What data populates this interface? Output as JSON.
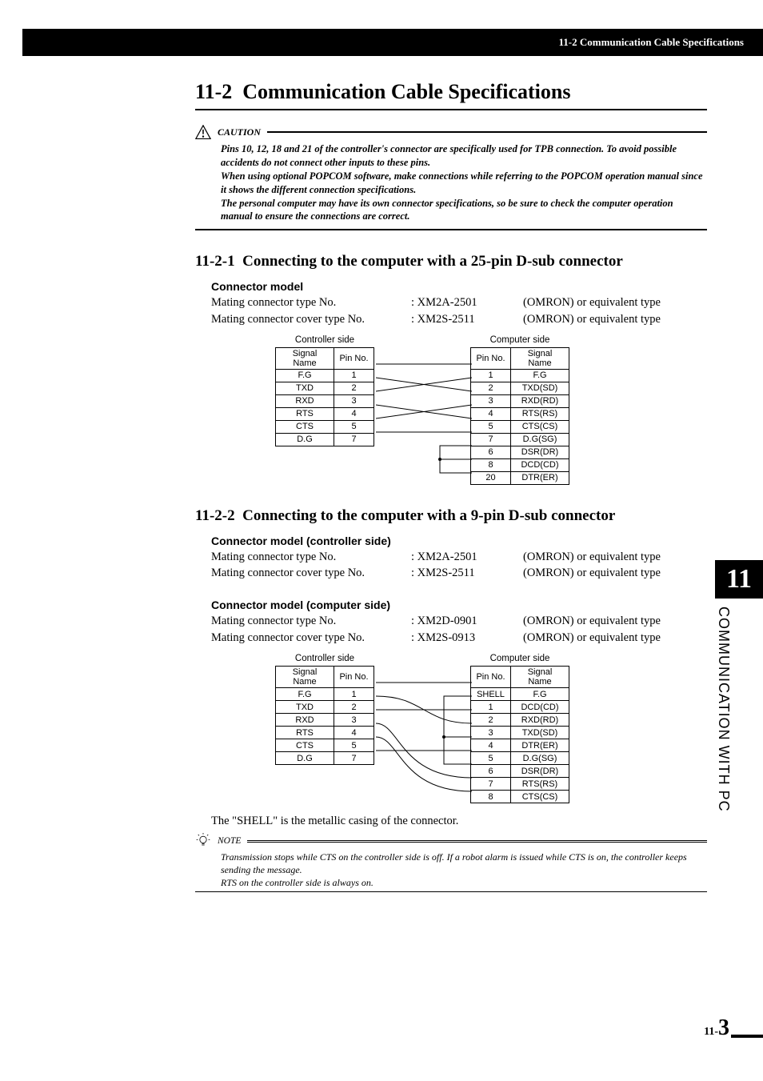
{
  "header": {
    "running_title": "11-2 Communication Cable Specifications"
  },
  "sidebar": {
    "chapter_number": "11",
    "vertical_label": "COMMUNICATION WITH PC"
  },
  "title": {
    "number": "11-2",
    "text": "Communication Cable Specifications"
  },
  "caution": {
    "label": "CAUTION",
    "lines": [
      "Pins 10, 12, 18 and 21 of the controller's connector are specifically used for TPB connection. To avoid possible accidents do not connect other inputs to these pins.",
      "When using optional POPCOM software, make connections while referring to the POPCOM operation manual since it shows the different connection specifications.",
      "The personal computer may have its own connector specifications, so be sure to check the computer operation manual to ensure the connections are correct."
    ]
  },
  "section_25pin": {
    "heading_number": "11-2-1",
    "heading_text": "Connecting to the computer with a 25-pin D-sub connector",
    "connector_label": "Connector model",
    "specs": [
      {
        "label": "Mating connector type No.",
        "value": ": XM2A-2501",
        "brand": "(OMRON) or equivalent type"
      },
      {
        "label": "Mating connector cover type No.",
        "value": ": XM2S-2511",
        "brand": "(OMRON) or equivalent type"
      }
    ],
    "controller_label": "Controller side",
    "computer_label": "Computer side",
    "table_headers": {
      "signal": "Signal Name",
      "pin": "Pin No."
    },
    "controller_rows": [
      {
        "signal": "F.G",
        "pin": "1"
      },
      {
        "signal": "TXD",
        "pin": "2"
      },
      {
        "signal": "RXD",
        "pin": "3"
      },
      {
        "signal": "RTS",
        "pin": "4"
      },
      {
        "signal": "CTS",
        "pin": "5"
      },
      {
        "signal": "D.G",
        "pin": "7"
      }
    ],
    "computer_rows": [
      {
        "pin": "1",
        "signal": "F.G"
      },
      {
        "pin": "2",
        "signal": "TXD(SD)"
      },
      {
        "pin": "3",
        "signal": "RXD(RD)"
      },
      {
        "pin": "4",
        "signal": "RTS(RS)"
      },
      {
        "pin": "5",
        "signal": "CTS(CS)"
      },
      {
        "pin": "7",
        "signal": "D.G(SG)"
      },
      {
        "pin": "6",
        "signal": "DSR(DR)"
      },
      {
        "pin": "8",
        "signal": "DCD(CD)"
      },
      {
        "pin": "20",
        "signal": "DTR(ER)"
      }
    ]
  },
  "section_9pin": {
    "heading_number": "11-2-2",
    "heading_text": "Connecting to the computer with a 9-pin D-sub connector",
    "controller_connector_label": "Connector model (controller side)",
    "controller_specs": [
      {
        "label": "Mating connector type No.",
        "value": ": XM2A-2501",
        "brand": "(OMRON) or equivalent type"
      },
      {
        "label": "Mating connector cover type No.",
        "value": ": XM2S-2511",
        "brand": "(OMRON) or equivalent type"
      }
    ],
    "computer_connector_label": "Connector model (computer side)",
    "computer_specs": [
      {
        "label": "Mating connector type No.",
        "value": ": XM2D-0901",
        "brand": "(OMRON) or equivalent type"
      },
      {
        "label": "Mating connector cover type No.",
        "value": ": XM2S-0913",
        "brand": "(OMRON) or equivalent type"
      }
    ],
    "controller_label": "Controller side",
    "computer_label": "Computer side",
    "table_headers": {
      "signal": "Signal Name",
      "pin": "Pin No."
    },
    "controller_rows": [
      {
        "signal": "F.G",
        "pin": "1"
      },
      {
        "signal": "TXD",
        "pin": "2"
      },
      {
        "signal": "RXD",
        "pin": "3"
      },
      {
        "signal": "RTS",
        "pin": "4"
      },
      {
        "signal": "CTS",
        "pin": "5"
      },
      {
        "signal": "D.G",
        "pin": "7"
      }
    ],
    "computer_rows": [
      {
        "pin": "SHELL",
        "signal": "F.G"
      },
      {
        "pin": "1",
        "signal": "DCD(CD)"
      },
      {
        "pin": "2",
        "signal": "RXD(RD)"
      },
      {
        "pin": "3",
        "signal": "TXD(SD)"
      },
      {
        "pin": "4",
        "signal": "DTR(ER)"
      },
      {
        "pin": "5",
        "signal": "D.G(SG)"
      },
      {
        "pin": "6",
        "signal": "DSR(DR)"
      },
      {
        "pin": "7",
        "signal": "RTS(RS)"
      },
      {
        "pin": "8",
        "signal": "CTS(CS)"
      }
    ]
  },
  "shell_note": "The \"SHELL\" is the metallic casing of the connector.",
  "note": {
    "label": "NOTE",
    "lines": [
      "Transmission stops while CTS on the controller side is off. If a robot alarm is issued while CTS is on,  the controller keeps sending the message.",
      "RTS on the controller side is always on."
    ]
  },
  "page_number": {
    "prefix": "11-",
    "num": "3"
  }
}
